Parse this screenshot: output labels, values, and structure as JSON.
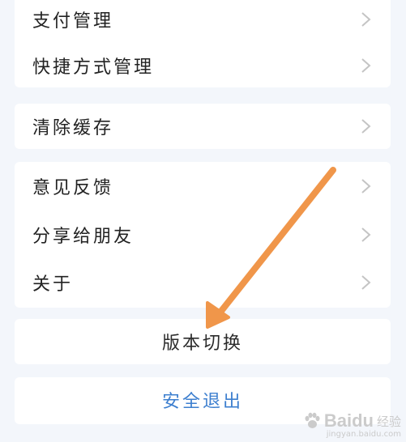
{
  "menu": {
    "group1": [
      {
        "label": "支付管理"
      },
      {
        "label": "快捷方式管理"
      }
    ],
    "group2": [
      {
        "label": "清除缓存"
      }
    ],
    "group3": [
      {
        "label": "意见反馈"
      },
      {
        "label": "分享给朋友"
      },
      {
        "label": "关于"
      }
    ],
    "version_switch_label": "版本切换",
    "logout_label": "安全退出"
  },
  "watermark": {
    "brand": "Baidu",
    "suffix": "经验",
    "url": "jingyan.baidu.com"
  },
  "colors": {
    "background": "#f3f6fb",
    "card": "#ffffff",
    "text": "#222222",
    "logout": "#3d7fcf",
    "chevron": "#c4c4c4",
    "annotation_arrow": "#f0964a"
  }
}
